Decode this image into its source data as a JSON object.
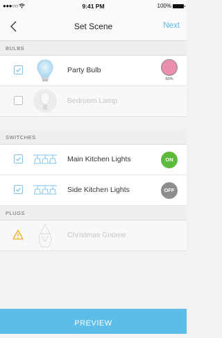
{
  "status_bar": {
    "signal": "●●●○○",
    "wifi": "wifi-icon",
    "time": "9:41 PM",
    "battery": "100%"
  },
  "nav": {
    "back_icon": "chevron-left-icon",
    "title": "Set Scene",
    "next_label": "Next"
  },
  "sections": {
    "bulbs": "BULBS",
    "switches": "SWITCHES",
    "plugs": "PLUGS"
  },
  "bulbs": [
    {
      "label": "Party Bulb",
      "checked": true,
      "color": "#e98eac",
      "brightness": "60%",
      "enabled": true
    },
    {
      "label": "Bedroom Lamp",
      "checked": false,
      "enabled": false
    }
  ],
  "switches": [
    {
      "label": "Main Kitchen Lights",
      "checked": true,
      "state": "ON",
      "state_color": "#5dbb3c"
    },
    {
      "label": "Side Kitchen Lights",
      "checked": true,
      "state": "OFF",
      "state_color": "#8e8e90"
    }
  ],
  "plugs": [
    {
      "label": "Christmas Gnome",
      "warning": true,
      "enabled": false
    }
  ],
  "preview_label": "PREVIEW",
  "colors": {
    "accent": "#5bbde8",
    "warning": "#f0a500"
  }
}
